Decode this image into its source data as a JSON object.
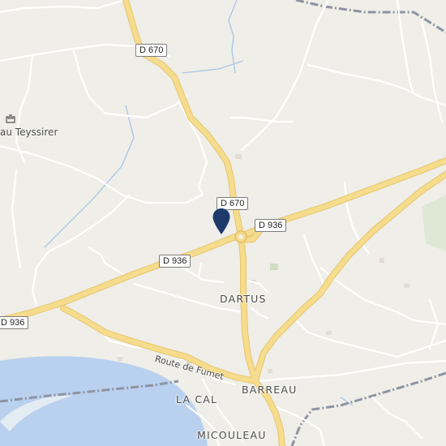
{
  "map": {
    "colors": {
      "land": "#efeee8",
      "water": "#b9d1ee",
      "major_road": "#f6dc8d",
      "major_road_casing": "#e7c56c",
      "minor_road": "#ffffff",
      "boundary": "#8c94a3",
      "marker": "#1e3a6b"
    },
    "road_shields": [
      {
        "id": "d670-north",
        "label": "D 670"
      },
      {
        "id": "d670-junction",
        "label": "D 670"
      },
      {
        "id": "d936-east",
        "label": "D 936"
      },
      {
        "id": "d936-mid",
        "label": "D 936"
      },
      {
        "id": "d936-west",
        "label": "D 936"
      }
    ],
    "places": [
      {
        "id": "dartus",
        "label": "DARTUS"
      },
      {
        "id": "barreau",
        "label": "BARREAU"
      },
      {
        "id": "la-cal",
        "label": "LA CAL"
      },
      {
        "id": "micouleau",
        "label": "MICOULEAU"
      }
    ],
    "poi": {
      "label": "au Teyssirer",
      "icon": "castle-icon"
    },
    "road_label": "Route de Fumet",
    "marker": {
      "icon": "map-pin-icon"
    }
  }
}
